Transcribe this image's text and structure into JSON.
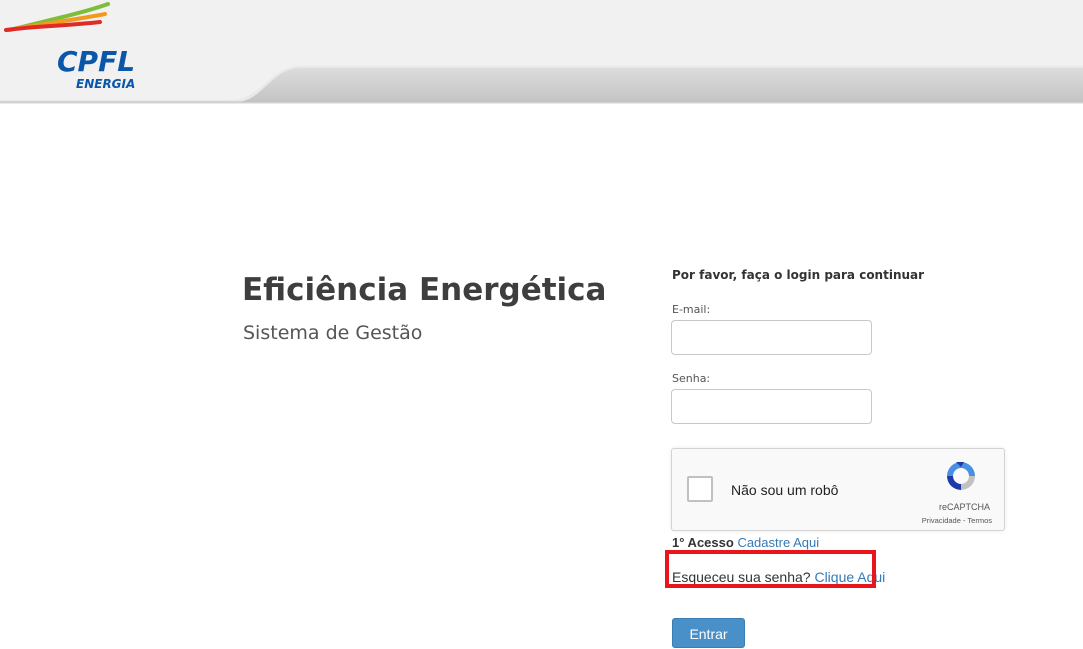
{
  "brand": {
    "logo_main": "CPFL",
    "logo_sub": "ENERGIA",
    "primary_color": "#0a56a8",
    "accent_colors": [
      "#e02a27",
      "#f29a1f",
      "#7cbd3b"
    ]
  },
  "app": {
    "title": "Eficiência Energética",
    "subtitle": "Sistema de Gestão"
  },
  "login": {
    "prompt": "Por favor, faça o login para continuar",
    "email_label": "E-mail:",
    "email_value": "",
    "password_label": "Senha:",
    "password_value": "",
    "recaptcha": {
      "checkbox_label": "Não sou um robô",
      "brand": "reCAPTCHA",
      "links": "Privacidade - Termos"
    },
    "first_access_label": "1° Acesso",
    "first_access_link": "Cadastre Aqui",
    "forgot_label": "Esqueceu sua senha?",
    "forgot_link": "Clique Aqui",
    "submit_label": "Entrar"
  },
  "annotation": {
    "highlight_color": "#e8161b"
  }
}
